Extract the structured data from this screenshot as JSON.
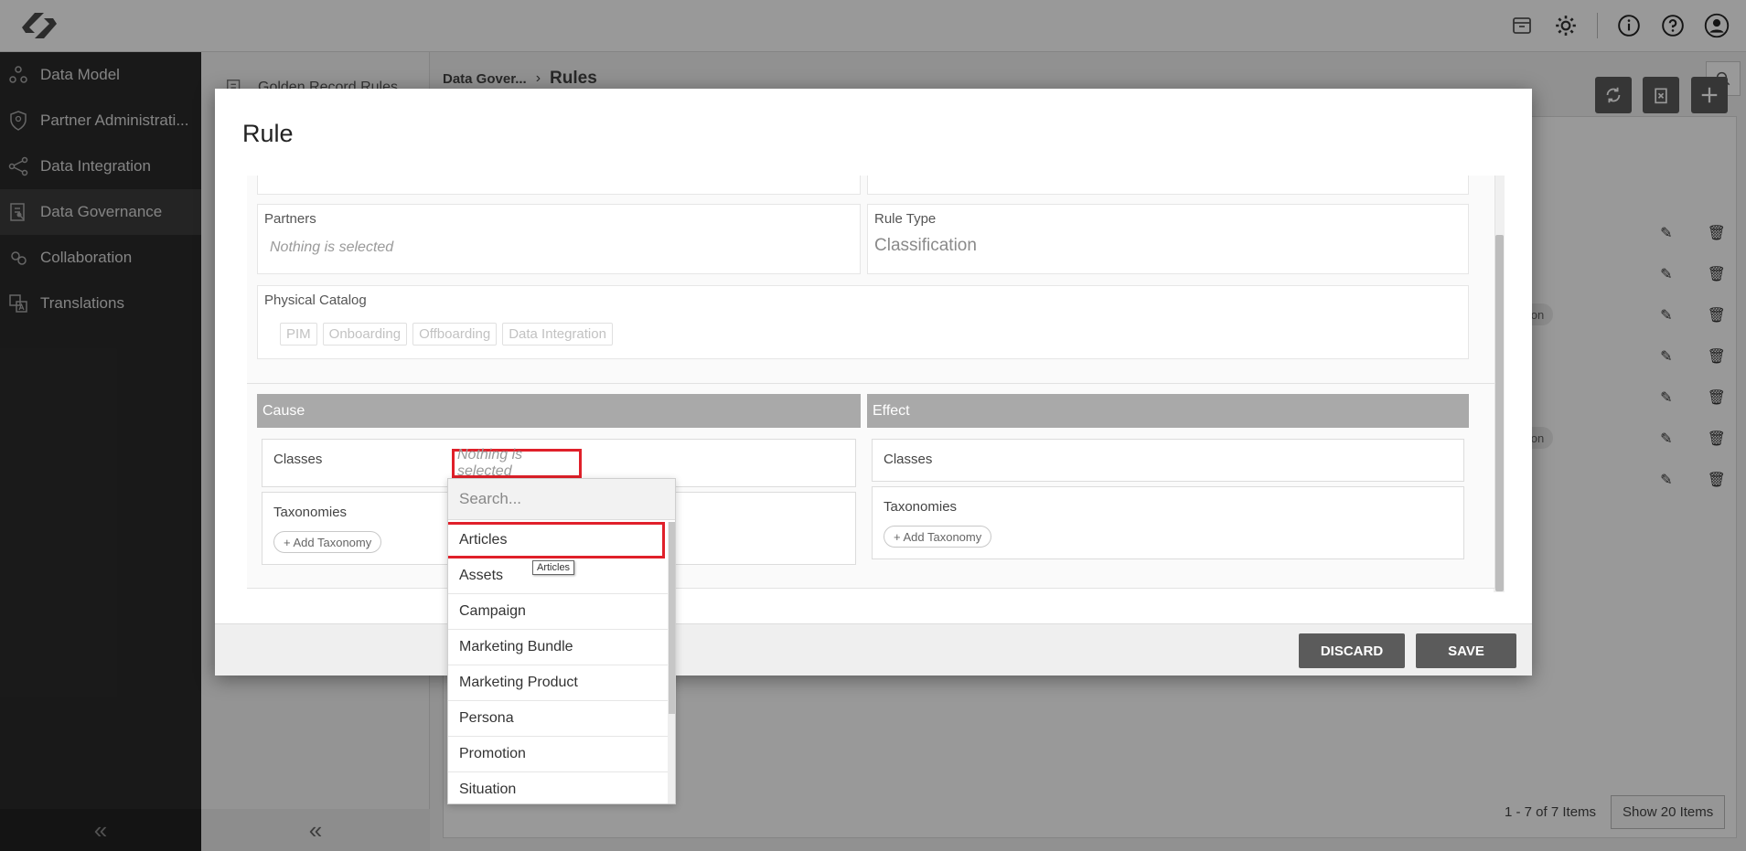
{
  "sidebar": {
    "items": [
      {
        "label": "Data Model",
        "icon": "data-model-icon"
      },
      {
        "label": "Partner Administrati...",
        "icon": "shield-icon"
      },
      {
        "label": "Data Integration",
        "icon": "share-nodes-icon"
      },
      {
        "label": "Data Governance",
        "icon": "governance-icon",
        "active": true
      },
      {
        "label": "Collaboration",
        "icon": "collaboration-icon"
      },
      {
        "label": "Translations",
        "icon": "translate-icon"
      }
    ],
    "collapse_glyph": "«"
  },
  "subpanel": {
    "item_label": "Golden Record Rules",
    "collapse_glyph": "«"
  },
  "breadcrumb": {
    "parent": "Data Gover...",
    "separator": "›",
    "current": "Rules"
  },
  "pager": {
    "range_text": "1 - 7 of 7 Items",
    "show_label": "Show 20 Items"
  },
  "row_chips": [
    "ation",
    "ation"
  ],
  "modal": {
    "title": "Rule",
    "partners": {
      "label": "Partners",
      "placeholder": "Nothing is selected"
    },
    "rule_type": {
      "label": "Rule Type",
      "value": "Classification"
    },
    "physical_catalog": {
      "label": "Physical Catalog",
      "chips": [
        "PIM",
        "Onboarding",
        "Offboarding",
        "Data Integration"
      ]
    },
    "cause": {
      "header": "Cause",
      "classes_label": "Classes",
      "classes_placeholder": "Nothing is selected",
      "taxonomies_label": "Taxonomies",
      "add_taxonomy": "+ Add Taxonomy"
    },
    "effect": {
      "header": "Effect",
      "classes_label": "Classes",
      "taxonomies_label": "Taxonomies",
      "add_taxonomy": "+ Add Taxonomy"
    },
    "footer": {
      "discard": "DISCARD",
      "save": "SAVE"
    }
  },
  "dropdown": {
    "search_placeholder": "Search...",
    "options": [
      "Articles",
      "Assets",
      "Campaign",
      "Marketing Bundle",
      "Marketing Product",
      "Persona",
      "Promotion",
      "Situation"
    ],
    "highlighted": "Articles",
    "tooltip": "Articles"
  },
  "colors": {
    "sidebar_bg": "#2b2b2b",
    "highlight_red": "#e0202a",
    "button_dark": "#5b5b5b",
    "section_header": "#a9a9a9"
  }
}
